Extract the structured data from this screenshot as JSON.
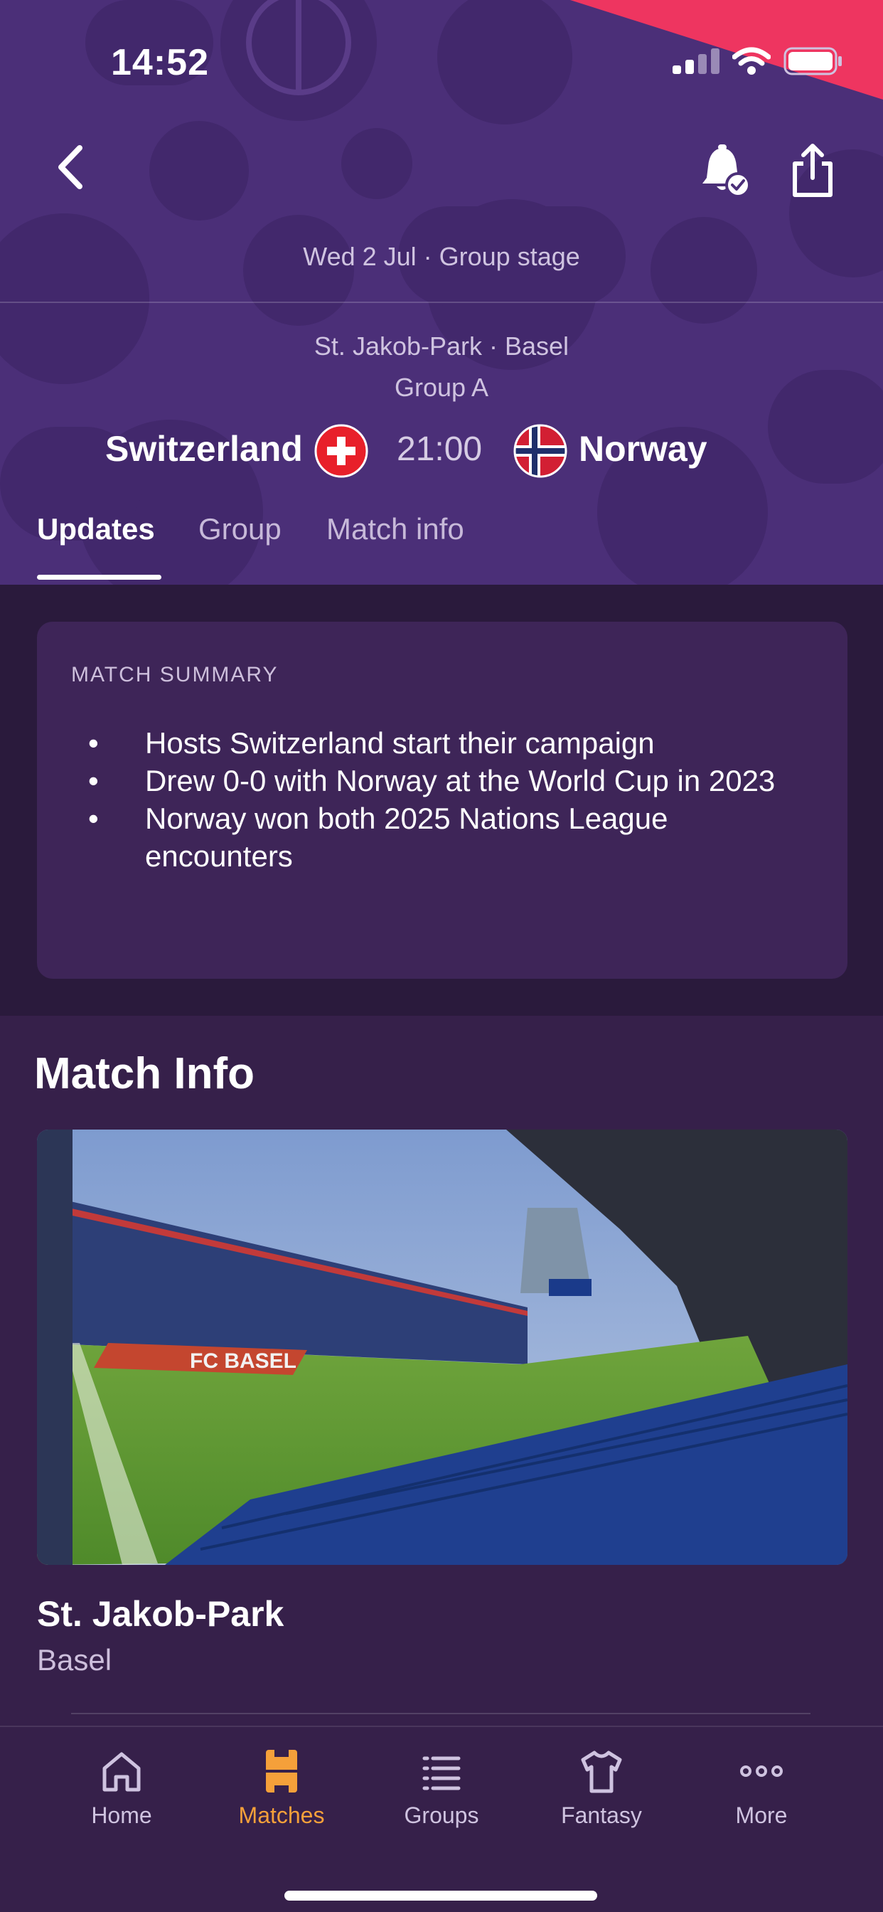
{
  "status_bar": {
    "time": "14:52"
  },
  "header": {
    "date_stage": "Wed 2 Jul · Group stage",
    "venue": "St. Jakob-Park · Basel",
    "group": "Group A",
    "home_team": "Switzerland",
    "away_team": "Norway",
    "kickoff": "21:00"
  },
  "tabs": [
    {
      "label": "Updates",
      "active": true
    },
    {
      "label": "Group",
      "active": false
    },
    {
      "label": "Match info",
      "active": false
    }
  ],
  "summary": {
    "title": "MATCH SUMMARY",
    "bullets": [
      "Hosts Switzerland start their campaign",
      "Drew 0-0 with Norway at the World Cup in 2023",
      "Norway won both 2025 Nations League encounters"
    ]
  },
  "match_info": {
    "heading": "Match Info",
    "stadium_name": "St. Jakob-Park",
    "city": "Basel",
    "stadium_banner_text": "FC BASEL"
  },
  "bottom_nav": [
    {
      "label": "Home",
      "icon": "home-icon",
      "active": false
    },
    {
      "label": "Matches",
      "icon": "pitch-icon",
      "active": true
    },
    {
      "label": "Groups",
      "icon": "list-icon",
      "active": false
    },
    {
      "label": "Fantasy",
      "icon": "shirt-icon",
      "active": false
    },
    {
      "label": "More",
      "icon": "more-icon",
      "active": false
    }
  ],
  "colors": {
    "header_bg": "#4b2f78",
    "page_bg": "#36204a",
    "card_bg": "#3e2558",
    "accent_active": "#f5a03a",
    "corner_accent": "#ee3560"
  }
}
